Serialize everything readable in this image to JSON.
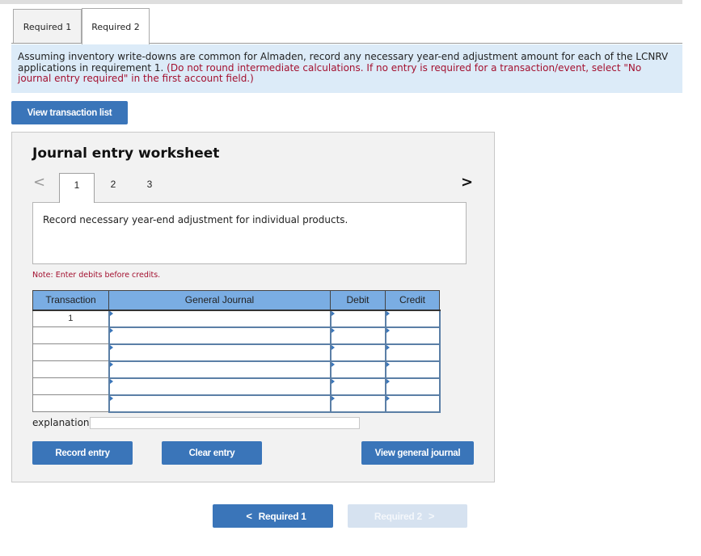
{
  "tabs": [
    {
      "label": "Required 1",
      "active": false
    },
    {
      "label": "Required 2",
      "active": true
    }
  ],
  "instructions": {
    "main": "Assuming inventory write-downs are common for Almaden, record any necessary year-end adjustment amount for each of the LCNRV applications in requirement 1. ",
    "note": "(Do not round intermediate calculations. If no entry is required for a transaction/event, select \"No journal entry required\" in the first account field.)"
  },
  "buttons": {
    "view_transaction_list": "View transaction list",
    "record_entry": "Record entry",
    "clear_entry": "Clear entry",
    "view_general_journal": "View general journal"
  },
  "worksheet": {
    "title": "Journal entry worksheet",
    "pages": [
      "1",
      "2",
      "3"
    ],
    "active_page": "1",
    "description": "Record necessary year-end adjustment for individual products.",
    "note": "Note: Enter debits before credits.",
    "columns": [
      "Transaction",
      "General Journal",
      "Debit",
      "Credit"
    ],
    "rows": [
      {
        "transaction": "1",
        "account": "",
        "debit": "",
        "credit": ""
      },
      {
        "transaction": "",
        "account": "",
        "debit": "",
        "credit": ""
      },
      {
        "transaction": "",
        "account": "",
        "debit": "",
        "credit": ""
      },
      {
        "transaction": "",
        "account": "",
        "debit": "",
        "credit": ""
      },
      {
        "transaction": "",
        "account": "",
        "debit": "",
        "credit": ""
      },
      {
        "transaction": "",
        "account": "",
        "debit": "",
        "credit": ""
      }
    ],
    "explanation_label": "explanation",
    "explanation_value": ""
  },
  "bottom_nav": {
    "prev_label": "Required 1",
    "next_label": "Required 2",
    "next_disabled": true
  },
  "icons": {
    "prev": "‹",
    "next": "›",
    "chevron_left": "<",
    "chevron_right": ">"
  }
}
